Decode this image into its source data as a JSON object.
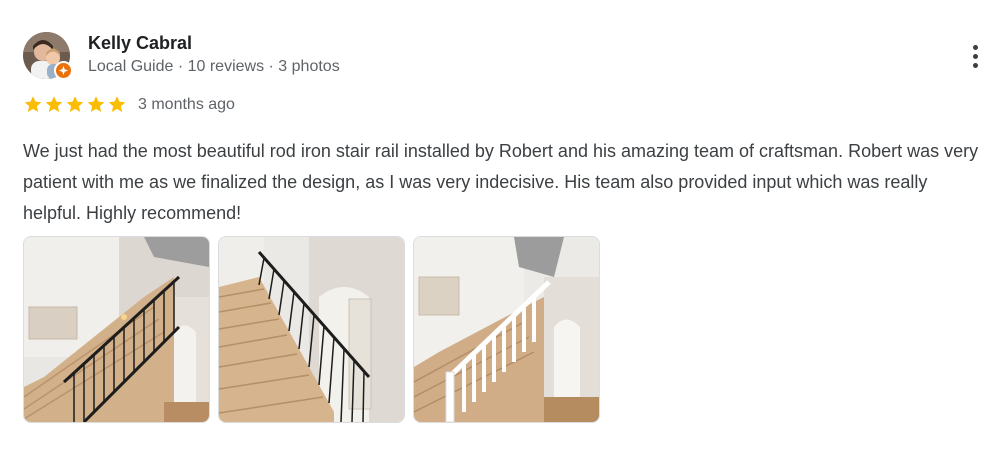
{
  "reviewer": {
    "name": "Kelly Cabral",
    "meta": "Local Guide · 10 reviews · 3 photos",
    "badge_color": "#e8710a"
  },
  "rating": {
    "stars": 5,
    "star_color": "#fbbc04",
    "time_ago": "3 months ago"
  },
  "review": {
    "text": "We just had the most beautiful rod iron stair rail installed by Robert and his amazing team of craftsman. Robert was very patient with me as we finalized the design, as I was very indecisive. His team also provided input which was really helpful. Highly recommend!"
  },
  "photos": [
    {
      "name": "photo-stairs-black-rail-1"
    },
    {
      "name": "photo-stairs-black-rail-2"
    },
    {
      "name": "photo-stairs-white-rail"
    }
  ],
  "icons": {
    "more": "more-vert-icon",
    "star": "star-icon",
    "badge": "local-guide-badge-icon"
  }
}
